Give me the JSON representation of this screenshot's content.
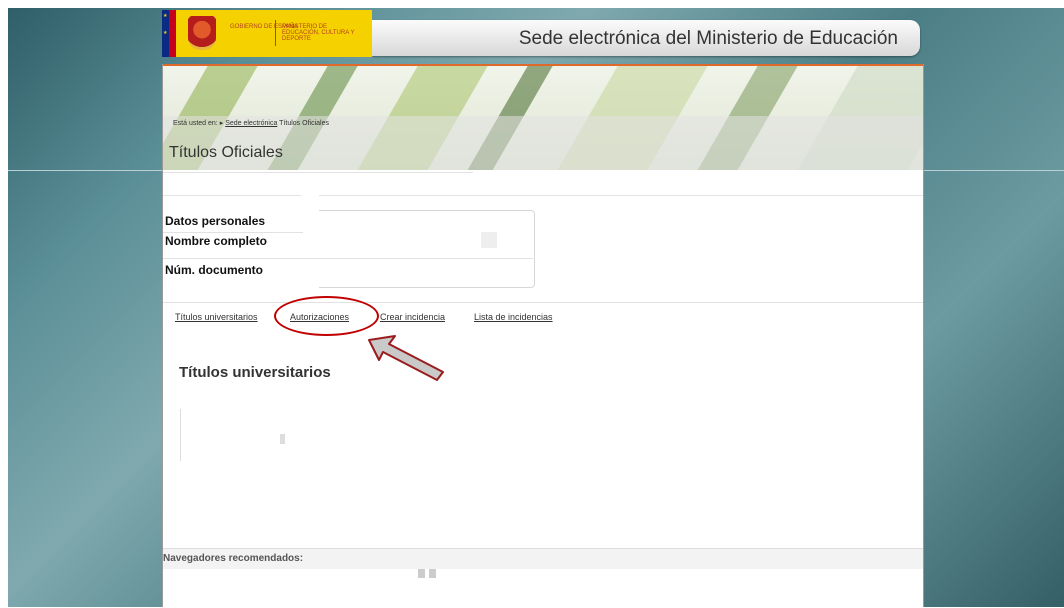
{
  "header": {
    "site_title": "Sede electrónica del Ministerio de Educación",
    "logo": {
      "gobierno": "GOBIERNO DE ESPAÑA",
      "ministerio": "MINISTERIO DE EDUCACIÓN, CULTURA Y DEPORTE"
    }
  },
  "breadcrumb": {
    "prefix": "Está usted en:",
    "link": "Sede electrónica",
    "current": "Títulos Oficiales"
  },
  "page_title": "Títulos Oficiales",
  "personal_data": {
    "heading": "Datos personales",
    "name_label": "Nombre completo",
    "doc_label": "Núm. documento"
  },
  "tabs": [
    {
      "label": "Títulos universitarios"
    },
    {
      "label": "Autorizaciones"
    },
    {
      "label": "Crear incidencia"
    },
    {
      "label": "Lista de incidencias"
    }
  ],
  "section_title": "Títulos universitarios",
  "footer": {
    "browsers_label": "Navegadores recomendados:"
  },
  "colors": {
    "highlight": "#c00000",
    "accent": "#e06a2b"
  }
}
